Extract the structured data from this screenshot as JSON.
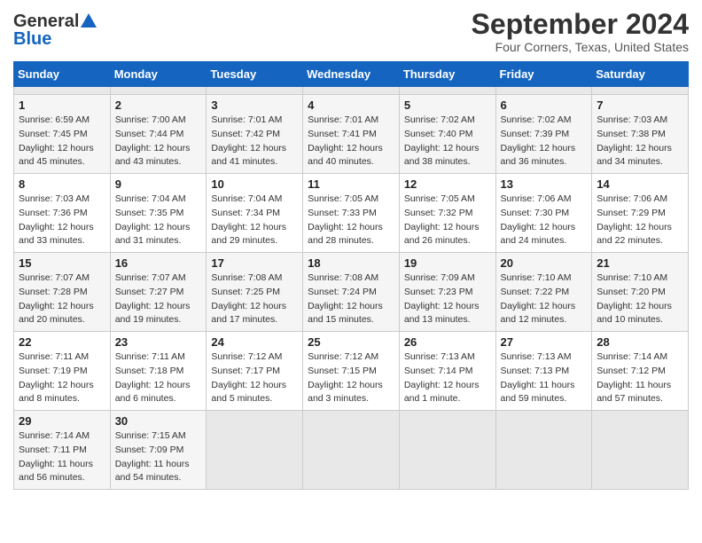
{
  "header": {
    "logo_general": "General",
    "logo_blue": "Blue",
    "title": "September 2024",
    "subtitle": "Four Corners, Texas, United States"
  },
  "calendar": {
    "days_of_week": [
      "Sunday",
      "Monday",
      "Tuesday",
      "Wednesday",
      "Thursday",
      "Friday",
      "Saturday"
    ],
    "weeks": [
      [
        {
          "day": "",
          "empty": true
        },
        {
          "day": "",
          "empty": true
        },
        {
          "day": "",
          "empty": true
        },
        {
          "day": "",
          "empty": true
        },
        {
          "day": "",
          "empty": true
        },
        {
          "day": "",
          "empty": true
        },
        {
          "day": "",
          "empty": true
        }
      ],
      [
        {
          "day": "1",
          "info": "Sunrise: 6:59 AM\nSunset: 7:45 PM\nDaylight: 12 hours\nand 45 minutes."
        },
        {
          "day": "2",
          "info": "Sunrise: 7:00 AM\nSunset: 7:44 PM\nDaylight: 12 hours\nand 43 minutes."
        },
        {
          "day": "3",
          "info": "Sunrise: 7:01 AM\nSunset: 7:42 PM\nDaylight: 12 hours\nand 41 minutes."
        },
        {
          "day": "4",
          "info": "Sunrise: 7:01 AM\nSunset: 7:41 PM\nDaylight: 12 hours\nand 40 minutes."
        },
        {
          "day": "5",
          "info": "Sunrise: 7:02 AM\nSunset: 7:40 PM\nDaylight: 12 hours\nand 38 minutes."
        },
        {
          "day": "6",
          "info": "Sunrise: 7:02 AM\nSunset: 7:39 PM\nDaylight: 12 hours\nand 36 minutes."
        },
        {
          "day": "7",
          "info": "Sunrise: 7:03 AM\nSunset: 7:38 PM\nDaylight: 12 hours\nand 34 minutes."
        }
      ],
      [
        {
          "day": "8",
          "info": "Sunrise: 7:03 AM\nSunset: 7:36 PM\nDaylight: 12 hours\nand 33 minutes."
        },
        {
          "day": "9",
          "info": "Sunrise: 7:04 AM\nSunset: 7:35 PM\nDaylight: 12 hours\nand 31 minutes."
        },
        {
          "day": "10",
          "info": "Sunrise: 7:04 AM\nSunset: 7:34 PM\nDaylight: 12 hours\nand 29 minutes."
        },
        {
          "day": "11",
          "info": "Sunrise: 7:05 AM\nSunset: 7:33 PM\nDaylight: 12 hours\nand 28 minutes."
        },
        {
          "day": "12",
          "info": "Sunrise: 7:05 AM\nSunset: 7:32 PM\nDaylight: 12 hours\nand 26 minutes."
        },
        {
          "day": "13",
          "info": "Sunrise: 7:06 AM\nSunset: 7:30 PM\nDaylight: 12 hours\nand 24 minutes."
        },
        {
          "day": "14",
          "info": "Sunrise: 7:06 AM\nSunset: 7:29 PM\nDaylight: 12 hours\nand 22 minutes."
        }
      ],
      [
        {
          "day": "15",
          "info": "Sunrise: 7:07 AM\nSunset: 7:28 PM\nDaylight: 12 hours\nand 20 minutes."
        },
        {
          "day": "16",
          "info": "Sunrise: 7:07 AM\nSunset: 7:27 PM\nDaylight: 12 hours\nand 19 minutes."
        },
        {
          "day": "17",
          "info": "Sunrise: 7:08 AM\nSunset: 7:25 PM\nDaylight: 12 hours\nand 17 minutes."
        },
        {
          "day": "18",
          "info": "Sunrise: 7:08 AM\nSunset: 7:24 PM\nDaylight: 12 hours\nand 15 minutes."
        },
        {
          "day": "19",
          "info": "Sunrise: 7:09 AM\nSunset: 7:23 PM\nDaylight: 12 hours\nand 13 minutes."
        },
        {
          "day": "20",
          "info": "Sunrise: 7:10 AM\nSunset: 7:22 PM\nDaylight: 12 hours\nand 12 minutes."
        },
        {
          "day": "21",
          "info": "Sunrise: 7:10 AM\nSunset: 7:20 PM\nDaylight: 12 hours\nand 10 minutes."
        }
      ],
      [
        {
          "day": "22",
          "info": "Sunrise: 7:11 AM\nSunset: 7:19 PM\nDaylight: 12 hours\nand 8 minutes."
        },
        {
          "day": "23",
          "info": "Sunrise: 7:11 AM\nSunset: 7:18 PM\nDaylight: 12 hours\nand 6 minutes."
        },
        {
          "day": "24",
          "info": "Sunrise: 7:12 AM\nSunset: 7:17 PM\nDaylight: 12 hours\nand 5 minutes."
        },
        {
          "day": "25",
          "info": "Sunrise: 7:12 AM\nSunset: 7:15 PM\nDaylight: 12 hours\nand 3 minutes."
        },
        {
          "day": "26",
          "info": "Sunrise: 7:13 AM\nSunset: 7:14 PM\nDaylight: 12 hours\nand 1 minute."
        },
        {
          "day": "27",
          "info": "Sunrise: 7:13 AM\nSunset: 7:13 PM\nDaylight: 11 hours\nand 59 minutes."
        },
        {
          "day": "28",
          "info": "Sunrise: 7:14 AM\nSunset: 7:12 PM\nDaylight: 11 hours\nand 57 minutes."
        }
      ],
      [
        {
          "day": "29",
          "info": "Sunrise: 7:14 AM\nSunset: 7:11 PM\nDaylight: 11 hours\nand 56 minutes."
        },
        {
          "day": "30",
          "info": "Sunrise: 7:15 AM\nSunset: 7:09 PM\nDaylight: 11 hours\nand 54 minutes."
        },
        {
          "day": "",
          "empty": true
        },
        {
          "day": "",
          "empty": true
        },
        {
          "day": "",
          "empty": true
        },
        {
          "day": "",
          "empty": true
        },
        {
          "day": "",
          "empty": true
        }
      ]
    ]
  }
}
